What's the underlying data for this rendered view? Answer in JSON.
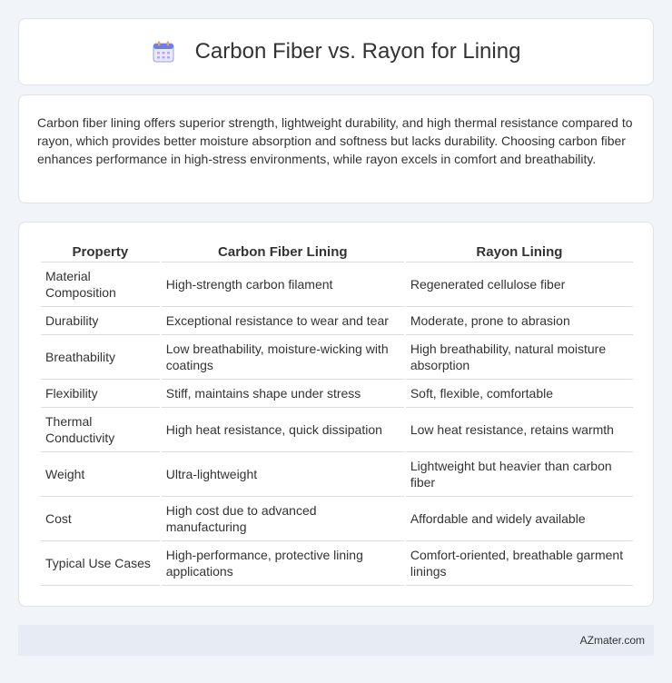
{
  "header": {
    "title": "Carbon Fiber vs. Rayon for Lining",
    "icon": "calendar-icon"
  },
  "intro": {
    "text": "Carbon fiber lining offers superior strength, lightweight durability, and high thermal resistance compared to rayon, which provides better moisture absorption and softness but lacks durability. Choosing carbon fiber enhances performance in high-stress environments, while rayon excels in comfort and breathability."
  },
  "table": {
    "headers": [
      "Property",
      "Carbon Fiber Lining",
      "Rayon Lining"
    ],
    "rows": [
      [
        "Material Composition",
        "High-strength carbon filament",
        "Regenerated cellulose fiber"
      ],
      [
        "Durability",
        "Exceptional resistance to wear and tear",
        "Moderate, prone to abrasion"
      ],
      [
        "Breathability",
        "Low breathability, moisture-wicking with coatings",
        "High breathability, natural moisture absorption"
      ],
      [
        "Flexibility",
        "Stiff, maintains shape under stress",
        "Soft, flexible, comfortable"
      ],
      [
        "Thermal Conductivity",
        "High heat resistance, quick dissipation",
        "Low heat resistance, retains warmth"
      ],
      [
        "Weight",
        "Ultra-lightweight",
        "Lightweight but heavier than carbon fiber"
      ],
      [
        "Cost",
        "High cost due to advanced manufacturing",
        "Affordable and widely available"
      ],
      [
        "Typical Use Cases",
        "High-performance, protective lining applications",
        "Comfort-oriented, breathable garment linings"
      ]
    ]
  },
  "footer": {
    "text": "AZmater.com"
  }
}
